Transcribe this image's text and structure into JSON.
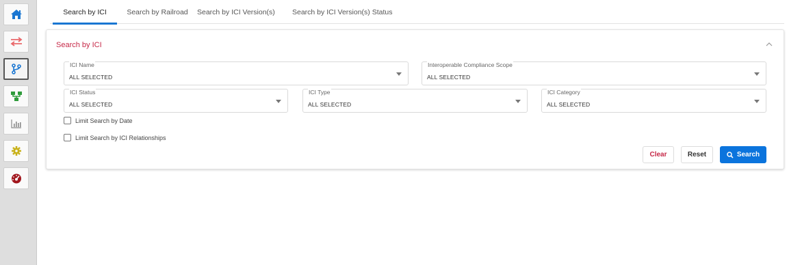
{
  "rail": {
    "items": [
      {
        "name": "home",
        "icon": "home-icon",
        "color": "#1976d2"
      },
      {
        "name": "transfer",
        "icon": "swap-arrows-icon",
        "color": "#e9686b"
      },
      {
        "name": "versions",
        "icon": "branch-icon",
        "color": "#1976d2",
        "active": true
      },
      {
        "name": "hierarchy",
        "icon": "sitemap-icon",
        "color": "#2e9b3b"
      },
      {
        "name": "reports",
        "icon": "bar-chart-icon",
        "color": "#8a8a8a"
      },
      {
        "name": "settings",
        "icon": "gear-icon",
        "color": "#c9b21c"
      },
      {
        "name": "dashboard",
        "icon": "speedometer-icon",
        "color": "#a1161d"
      }
    ]
  },
  "tabs": [
    {
      "label": "Search by ICI",
      "active": true
    },
    {
      "label": "Search by Railroad",
      "active": false
    },
    {
      "label": "Search by ICI Version(s)",
      "active": false
    },
    {
      "label": "Search by ICI Version(s) Status",
      "active": false
    }
  ],
  "card": {
    "title": "Search by ICI",
    "fields": {
      "ici_name": {
        "label": "ICI Name",
        "value": "ALL SELECTED"
      },
      "compliance_scope": {
        "label": "Interoperable Compliance Scope",
        "value": "ALL SELECTED"
      },
      "ici_status": {
        "label": "ICI Status",
        "value": "ALL SELECTED"
      },
      "ici_type": {
        "label": "ICI Type",
        "value": "ALL SELECTED"
      },
      "ici_category": {
        "label": "ICI Category",
        "value": "ALL SELECTED"
      }
    },
    "checkboxes": {
      "limit_date": {
        "label": "Limit Search by Date",
        "checked": false
      },
      "limit_relationships": {
        "label": "Limit Search by ICI Relationships",
        "checked": false
      }
    },
    "buttons": {
      "clear": "Clear",
      "reset": "Reset",
      "search": "Search"
    }
  },
  "colors": {
    "accent": "#1976d2",
    "title_red": "#c62847",
    "search_button": "#0b74dd"
  }
}
